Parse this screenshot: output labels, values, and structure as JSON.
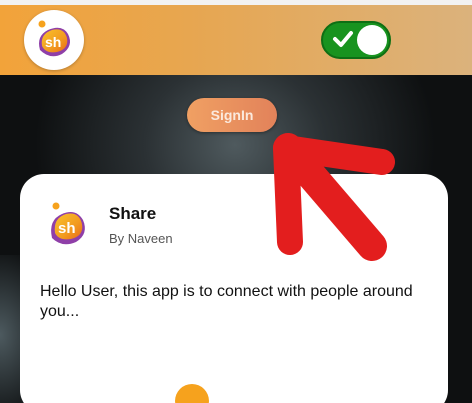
{
  "header": {
    "logo_icon": "sh-logo-icon",
    "logo_text": "sh",
    "theme_toggle": {
      "state": "on",
      "icon": "check-icon",
      "color": "#18931f"
    },
    "gradient_start": "#f2a33a",
    "gradient_end": "#dbb27c"
  },
  "hero": {
    "signin_label": "SignIn",
    "signin_color": "#e88b5e"
  },
  "card": {
    "logo_icon": "sh-logo-icon",
    "logo_text": "sh",
    "title": "Share",
    "author": "By Naveen",
    "message": "Hello User, this app is to connect with people around you..."
  },
  "annotation": {
    "icon": "arrow-icon",
    "color": "#e31e1e"
  }
}
